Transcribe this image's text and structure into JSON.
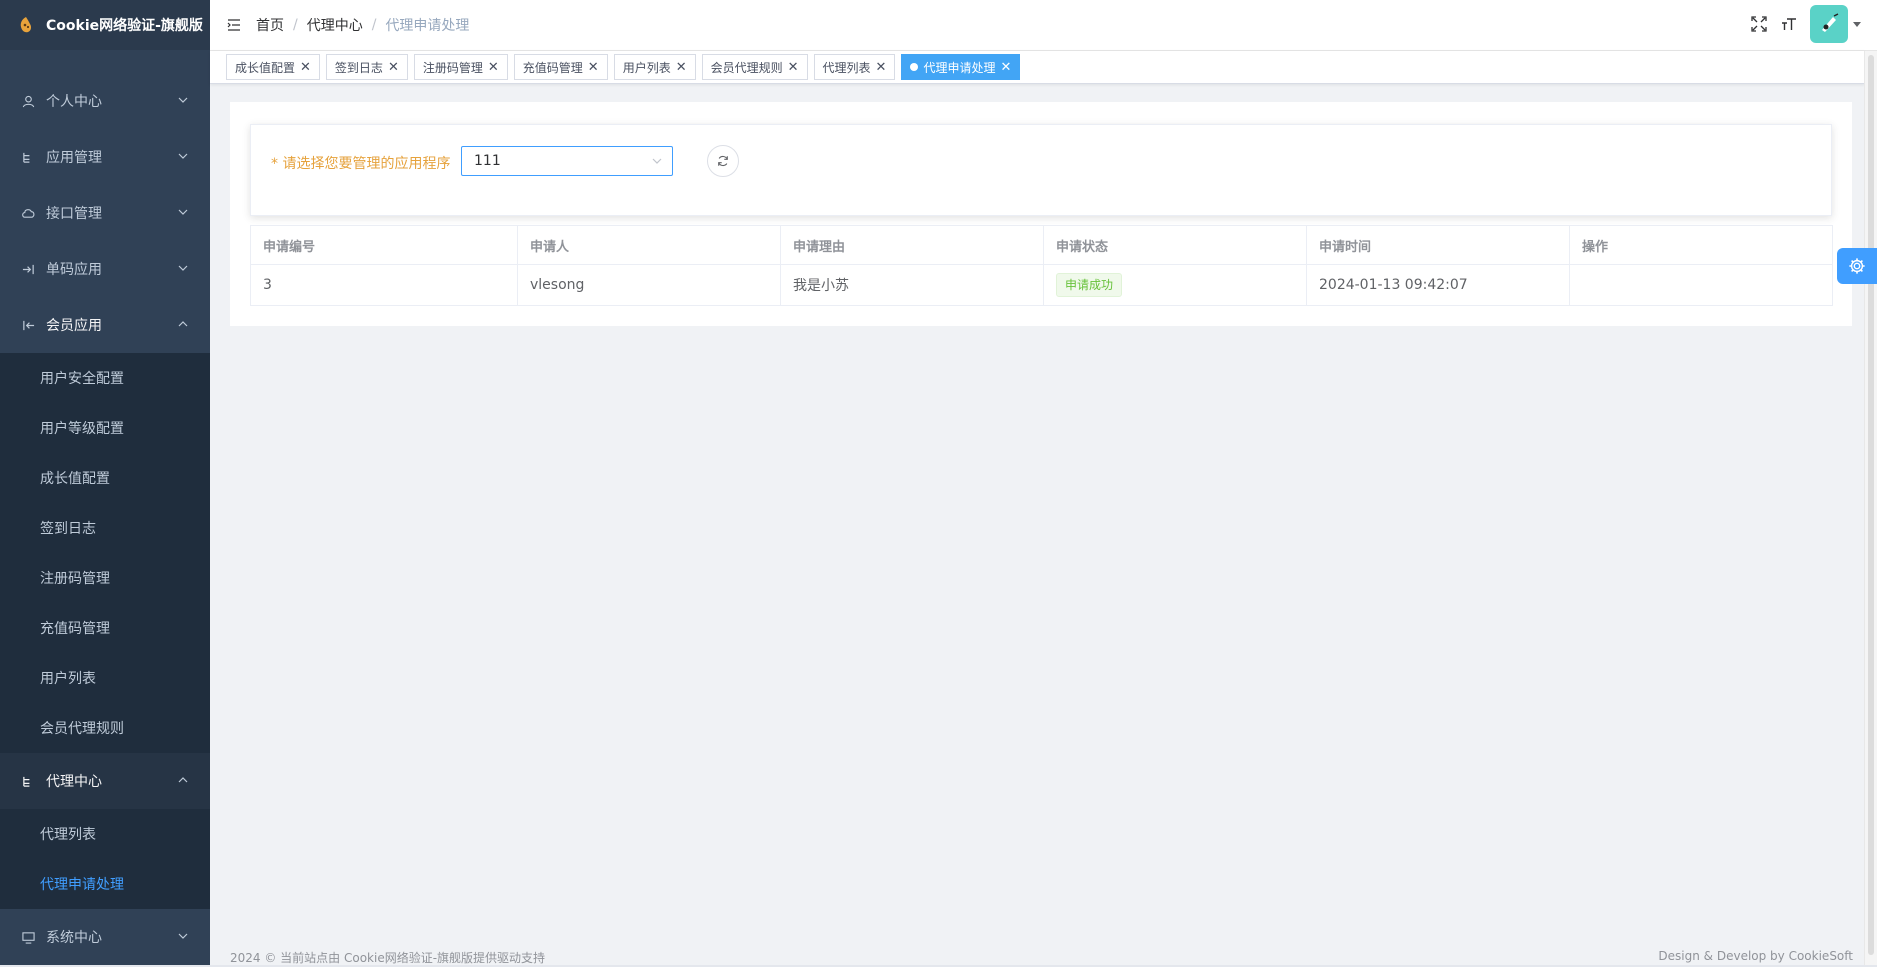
{
  "app": {
    "title": "Cookie网络验证-旗舰版"
  },
  "sidebar": {
    "items": [
      {
        "label": "个人中心",
        "icon": "user-icon"
      },
      {
        "label": "应用管理",
        "icon": "tree-icon"
      },
      {
        "label": "接口管理",
        "icon": "cloud-icon"
      },
      {
        "label": "单码应用",
        "icon": "login-icon"
      },
      {
        "label": "会员应用",
        "icon": "logout-icon"
      }
    ],
    "member_sub": [
      "用户安全配置",
      "用户等级配置",
      "成长值配置",
      "签到日志",
      "注册码管理",
      "充值码管理",
      "用户列表",
      "会员代理规则"
    ],
    "agent": {
      "label": "代理中心",
      "sub": [
        "代理列表",
        "代理申请处理"
      ]
    },
    "system": {
      "label": "系统中心"
    }
  },
  "breadcrumb": [
    "首页",
    "代理中心",
    "代理申请处理"
  ],
  "tags": [
    "成长值配置",
    "签到日志",
    "注册码管理",
    "充值码管理",
    "用户列表",
    "会员代理规则",
    "代理列表",
    "代理申请处理"
  ],
  "filter": {
    "label": "* 请选择您要管理的应用程序",
    "selected": "111"
  },
  "table": {
    "headers": [
      "申请编号",
      "申请人",
      "申请理由",
      "申请状态",
      "申请时间",
      "操作"
    ],
    "rows": [
      {
        "id": "3",
        "applicant": "vlesong",
        "reason": "我是小苏",
        "status": "申请成功",
        "time": "2024-01-13 09:42:07",
        "action": ""
      }
    ]
  },
  "footer": {
    "left": "2024 © 当前站点由 Cookie网络验证-旗舰版提供驱动支持",
    "right": "Design & Develop by CookieSoft"
  },
  "colors": {
    "sidebar": "#304156",
    "accent": "#409eff",
    "success": "#67c23a"
  }
}
